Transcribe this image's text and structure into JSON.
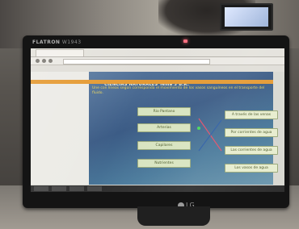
{
  "monitor": {
    "brand": "FLATRON",
    "model": "W1943",
    "logo": "LG"
  },
  "activity": {
    "title": "CIENCIAS NATURALES Tema 3 B.R.",
    "question": "Une con líneas según corresponda el movimiento de los vasos sanguíneos en el transporte del fluido.",
    "left_items": [
      "Rio Pantano",
      "Arterias",
      "Capilares",
      "Nutrientes"
    ],
    "right_items": [
      "A través de las venas",
      "Por corrientes de agua",
      "Las corrientes de agua",
      "Los vasos de agua"
    ]
  },
  "colors": {
    "accent_bar": "#e59a33",
    "page_bg": "#3c5c86",
    "box_fill": "#d8e4c0",
    "line_red": "#e0506a",
    "line_blue": "#2f5fa6",
    "active_dot": "#4ad55a"
  }
}
